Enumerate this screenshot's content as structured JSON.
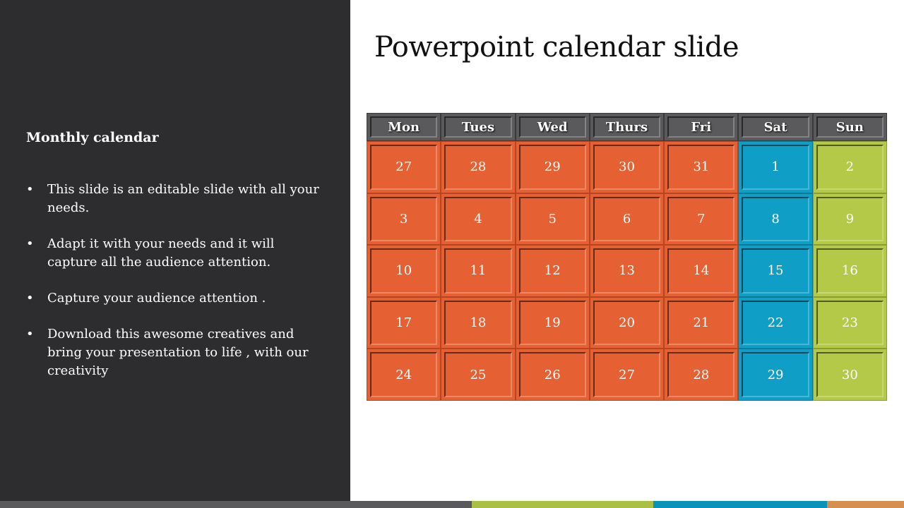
{
  "title": "Powerpoint calendar slide",
  "left_panel": {
    "subtitle": "Monthly calendar",
    "bullets": [
      "This slide is an editable slide with all your needs.",
      "Adapt it with your needs and it will capture all the audience attention.",
      "Capture your audience attention .",
      "Download this awesome creatives and bring your presentation to life , with our creativity"
    ],
    "bullet_char": "•"
  },
  "calendar": {
    "days": [
      "Mon",
      "Tues",
      "Wed",
      "Thurs",
      "Fri",
      "Sat",
      "Sun"
    ],
    "weeks": [
      [
        "27",
        "28",
        "29",
        "30",
        "31",
        "1",
        "2"
      ],
      [
        "3",
        "4",
        "5",
        "6",
        "7",
        "8",
        "9"
      ],
      [
        "10",
        "11",
        "12",
        "13",
        "14",
        "15",
        "16"
      ],
      [
        "17",
        "18",
        "19",
        "20",
        "21",
        "22",
        "23"
      ],
      [
        "24",
        "25",
        "26",
        "27",
        "28",
        "29",
        "30"
      ]
    ],
    "colors": {
      "header": "#5a5a5c",
      "weekday": "#e56033",
      "saturday": "#0e9ec6",
      "sunday": "#b5c948"
    }
  },
  "footer_stripe_colors": [
    "#5a5a5c",
    "#a9c045",
    "#0993b9",
    "#d58f4e"
  ]
}
